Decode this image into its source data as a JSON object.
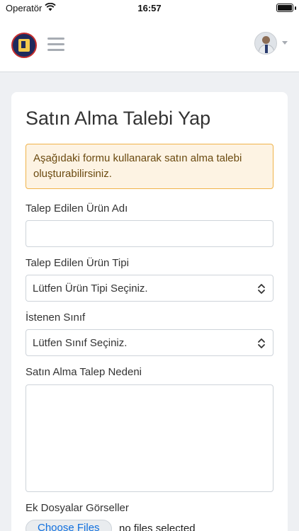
{
  "status_bar": {
    "carrier": "Operatör",
    "time": "16:57",
    "battery_level": 1.0
  },
  "header": {
    "logo_icon": "school-logo-icon",
    "menu_icon": "hamburger-icon",
    "avatar_icon": "user-avatar",
    "dropdown_icon": "caret-down-icon"
  },
  "form": {
    "title": "Satın Alma Talebi Yap",
    "alert_text": "Aşağıdaki formu kullanarak satın alma talebi oluşturabilirsiniz.",
    "product_name_label": "Talep Edilen Ürün Adı",
    "product_name_value": "",
    "product_type_label": "Talep Edilen Ürün Tipi",
    "product_type_selected": "Lütfen Ürün Tipi Seçiniz.",
    "class_label": "İstenen Sınıf",
    "class_selected": "Lütfen Sınıf Seçiniz.",
    "reason_label": "Satın Alma Talep Nedeni",
    "reason_value": "",
    "attachments_label": "Ek Dosyalar Görseller",
    "choose_files_label": "Choose Files",
    "no_files_text": "no files selected"
  },
  "colors": {
    "alert_background": "#fdf3e3",
    "alert_border": "#f0b34a",
    "link_blue": "#0f6fde",
    "page_background": "#eef0f3"
  }
}
